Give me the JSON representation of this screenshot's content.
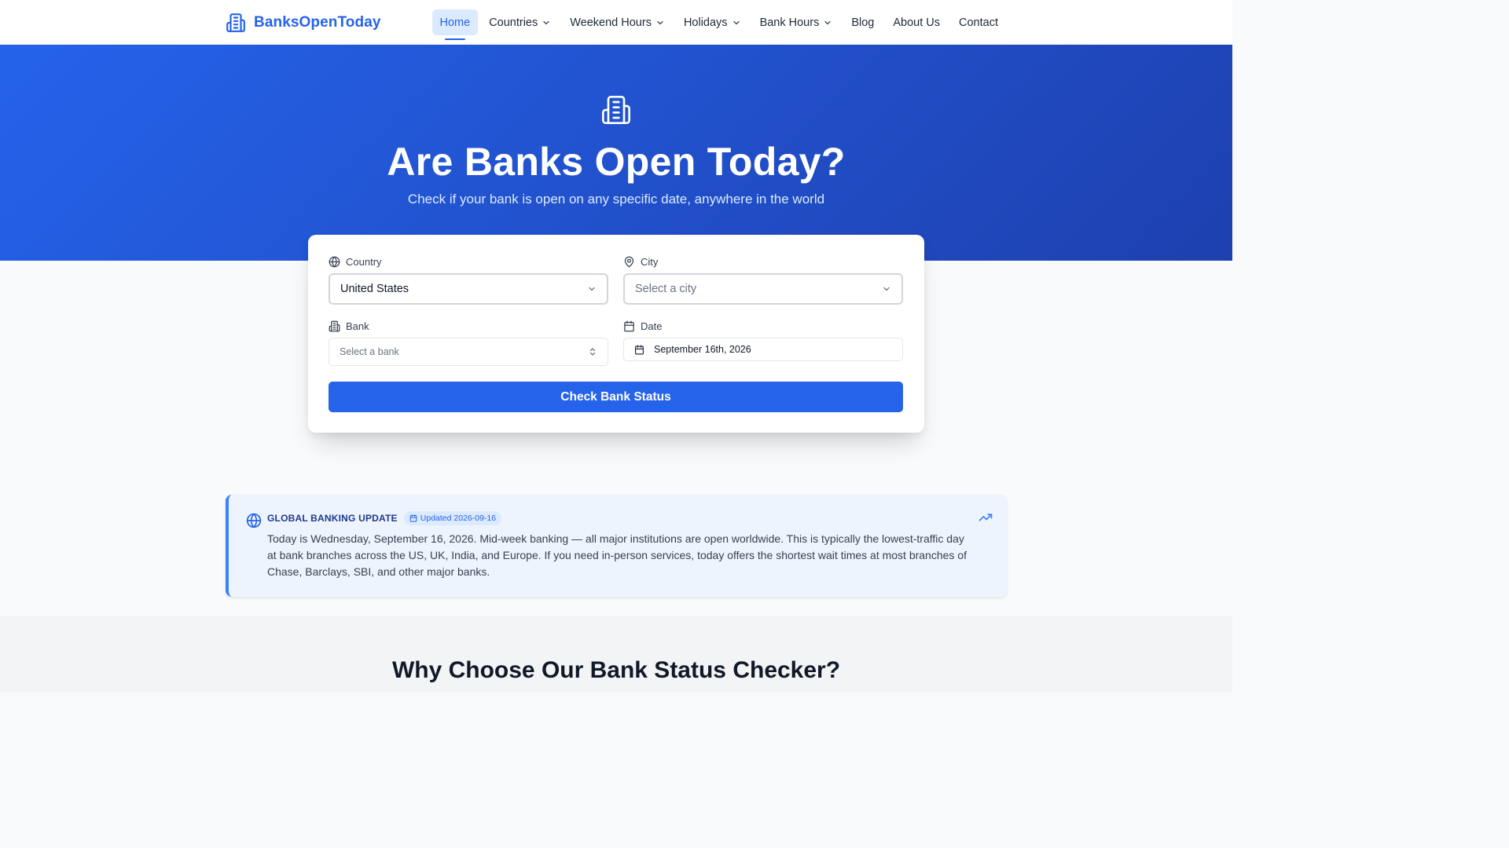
{
  "brand": {
    "name": "BanksOpenToday",
    "color": "#2563eb"
  },
  "nav": {
    "items": [
      {
        "label": "Home",
        "active": true,
        "dropdown": false
      },
      {
        "label": "Countries",
        "active": false,
        "dropdown": true
      },
      {
        "label": "Weekend Hours",
        "active": false,
        "dropdown": true
      },
      {
        "label": "Holidays",
        "active": false,
        "dropdown": true
      },
      {
        "label": "Bank Hours",
        "active": false,
        "dropdown": true
      },
      {
        "label": "Blog",
        "active": false,
        "dropdown": false
      },
      {
        "label": "About Us",
        "active": false,
        "dropdown": false
      },
      {
        "label": "Contact",
        "active": false,
        "dropdown": false
      }
    ]
  },
  "hero": {
    "icon": "building-icon",
    "title": "Are Banks Open Today?",
    "subtitle": "Check if your bank is open on any specific date, anywhere in the world"
  },
  "form": {
    "country": {
      "label": "Country",
      "icon": "globe-icon",
      "value": "United States"
    },
    "city": {
      "label": "City",
      "icon": "map-pin-icon",
      "placeholder": "Select a city"
    },
    "bank": {
      "label": "Bank",
      "icon": "building-icon",
      "placeholder": "Select a bank"
    },
    "date": {
      "label": "Date",
      "icon": "calendar-icon",
      "value": "September 16th, 2026"
    },
    "submit_label": "Check Bank Status"
  },
  "update": {
    "title": "GLOBAL BANKING UPDATE",
    "badge": "Updated 2026-09-16",
    "text": "Today is Wednesday, September 16, 2026. Mid-week banking — all major institutions are open worldwide. This is typically the lowest-traffic day at bank branches across the US, UK, India, and Europe. If you need in-person services, today offers the shortest wait times at most branches of Chase, Barclays, SBI, and other major banks."
  },
  "section": {
    "title": "Why Choose Our Bank Status Checker?"
  },
  "colors": {
    "primary": "#2563eb",
    "hero_from": "#2563eb",
    "hero_to": "#1e40af"
  }
}
